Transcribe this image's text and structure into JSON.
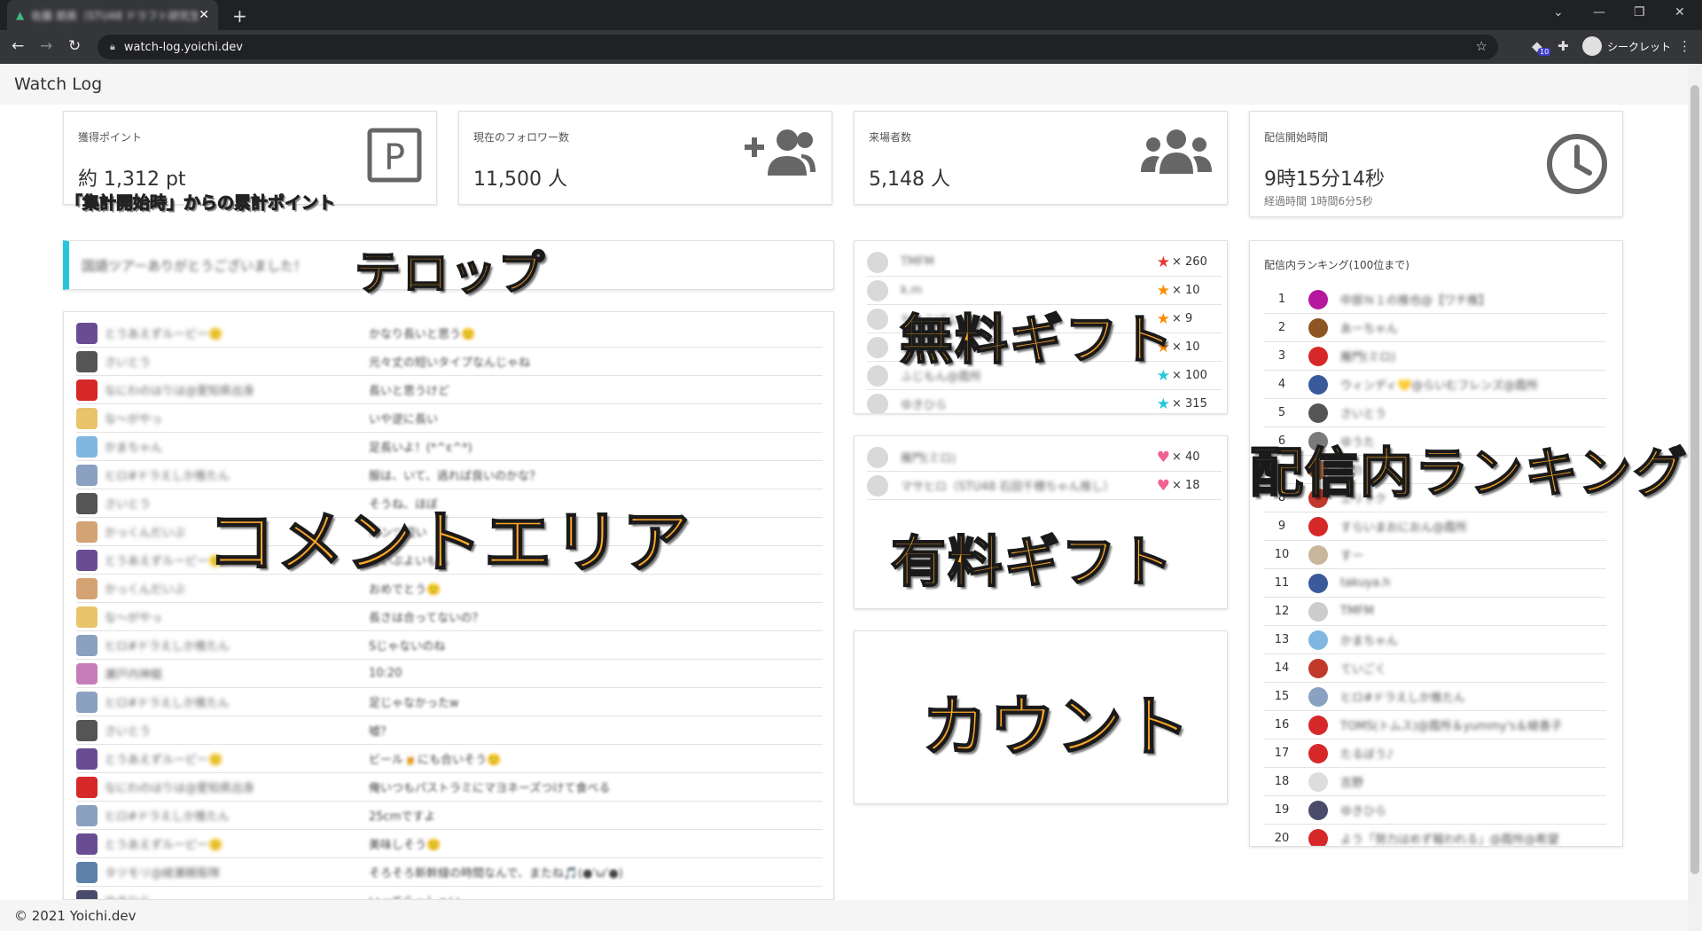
{
  "browser": {
    "tab_title": "佐藤 朋英（STU48 ドラフト研究生）",
    "url": "watch-log.yoichi.dev",
    "extension_badge": "10",
    "profile_label": "シークレット"
  },
  "app": {
    "title": "Watch Log",
    "footer": "© 2021 Yoichi.dev"
  },
  "stats": {
    "points": {
      "label": "獲得ポイント",
      "value": "約 1,312 pt",
      "icon": "parking-icon"
    },
    "followers": {
      "label": "現在のフォロワー数",
      "value": "11,500 人",
      "icon": "person-add-icon"
    },
    "visitors": {
      "label": "来場者数",
      "value": "5,148 人",
      "icon": "group-icon"
    },
    "start_time": {
      "label": "配信開始時間",
      "value": "9時15分14秒",
      "sub": "経過時間 1時間6分5秒",
      "icon": "clock-icon"
    }
  },
  "telop": {
    "text": "国語ツアーありがとうございました！"
  },
  "comments": [
    {
      "name": "とうあえずルーピー🙂",
      "text": "かなり長いと思う🙂",
      "color": "#6a4c93"
    },
    {
      "name": "さいとう",
      "text": "元々丈の短いタイプなんじゃね",
      "color": "#555555"
    },
    {
      "name": "なにわのはりは@愛知県出身",
      "text": "長いと思うけど",
      "color": "#d62828"
    },
    {
      "name": "な～がやっ",
      "text": "いや逆に長い",
      "color": "#e9c46a"
    },
    {
      "name": "かまちゃん",
      "text": "足長いよ！(*^ε^*)",
      "color": "#7fb7e0"
    },
    {
      "name": "ヒロ#ドラえしか推たん",
      "text": "服は、いて、逃れば良いのかな？",
      "color": "#8aa1c1"
    },
    {
      "name": "さいとう",
      "text": "そうね、ほぼ",
      "color": "#555555"
    },
    {
      "name": "かっくんだいぶ",
      "text": "パンツ短い",
      "color": "#d4a373"
    },
    {
      "name": "とうあえずルーピー🙂",
      "text": "だいぶよいもん",
      "color": "#6a4c93"
    },
    {
      "name": "かっくんだいぶ",
      "text": "おめでとう🙂",
      "color": "#d4a373"
    },
    {
      "name": "な～がやっ",
      "text": "長さは合ってないの？",
      "color": "#e9c46a"
    },
    {
      "name": "ヒロ#ドラえしか推たん",
      "text": "Sじゃないのね",
      "color": "#8aa1c1"
    },
    {
      "name": "瀬戸内神龍",
      "text": "10:20",
      "color": "#c77dba"
    },
    {
      "name": "ヒロ#ドラえしか推たん",
      "text": "足じゃなかったw",
      "color": "#8aa1c1"
    },
    {
      "name": "さいとう",
      "text": "嘘？",
      "color": "#555555"
    },
    {
      "name": "とうあえずルーピー🙂",
      "text": "ビール🍺にも合いそう🙂",
      "color": "#6a4c93"
    },
    {
      "name": "なにわのはりは@愛知県出身",
      "text": "俺いつもパストラミにマヨネーズつけて食べる",
      "color": "#d62828"
    },
    {
      "name": "ヒロ#ドラえしか推たん",
      "text": "25cmですよ",
      "color": "#8aa1c1"
    },
    {
      "name": "とうあえずルーピー🙂",
      "text": "美味しそう🙂",
      "color": "#6a4c93"
    },
    {
      "name": "タツモリ@綾瀬親衛隊",
      "text": "そろそろ新幹線の時間なんで、またね🎵(●'ω'●)",
      "color": "#5e81ac"
    },
    {
      "name": "ゆきひら",
      "text": "いってらっしゃい",
      "color": "#4a4a6a"
    }
  ],
  "free_gifts": [
    {
      "name": "TMFM",
      "icon": "red-star-icon",
      "symbol": "★",
      "color": "#e53935",
      "count": "× 260"
    },
    {
      "name": "k.m",
      "icon": "orange-star-icon",
      "symbol": "★",
      "color": "#fb8c00",
      "count": "× 10"
    },
    {
      "name": "ちょこぱん",
      "icon": "orange-star-icon",
      "symbol": "★",
      "color": "#fb8c00",
      "count": "× 9"
    },
    {
      "name": "かまちゃん",
      "icon": "orange-star-icon",
      "symbol": "★",
      "color": "#fb8c00",
      "count": "× 10"
    },
    {
      "name": "ふじもん@霞所",
      "icon": "teal-star-icon",
      "symbol": "★",
      "color": "#26c6da",
      "count": "× 100"
    },
    {
      "name": "ゆきひら",
      "icon": "teal-star-icon",
      "symbol": "★",
      "color": "#26c6da",
      "count": "× 315"
    }
  ],
  "paid_gifts": [
    {
      "name": "雁門(ミロ)",
      "icon": "pink-heart-icon",
      "symbol": "♥",
      "color": "#f06292",
      "count": "× 40"
    },
    {
      "name": "マサヒロ（STU48 石田千穂ちゃん推し）",
      "icon": "pink-heart-icon",
      "symbol": "♥",
      "color": "#f06292",
      "count": "× 18"
    }
  ],
  "ranking": {
    "title": "配信内ランキング(100位まで)",
    "items": [
      {
        "rank": "1",
        "name": "中部Ｎ１の推也@【ワチ推】",
        "color": "#b5179e"
      },
      {
        "rank": "2",
        "name": "あーちゃん",
        "color": "#8d5524"
      },
      {
        "rank": "3",
        "name": "雁門(ミロ)",
        "color": "#d62828"
      },
      {
        "rank": "4",
        "name": "ウィンディ💛@らいむフレンズ@霞所",
        "color": "#3a5a9c"
      },
      {
        "rank": "5",
        "name": "さいとう",
        "color": "#555555"
      },
      {
        "rank": "6",
        "name": "ゆうた",
        "color": "#7a7a7a"
      },
      {
        "rank": "7",
        "name": "きのこ",
        "color": "#9c6644"
      },
      {
        "rank": "8",
        "name": "エリック",
        "color": "#c0392b"
      },
      {
        "rank": "9",
        "name": "すらいまおにおん@霞所",
        "color": "#d62828"
      },
      {
        "rank": "10",
        "name": "すー",
        "color": "#c9b79c"
      },
      {
        "rank": "11",
        "name": "takuya.h",
        "color": "#3a5a9c"
      },
      {
        "rank": "12",
        "name": "TMFM",
        "color": "#cccccc"
      },
      {
        "rank": "13",
        "name": "かまちゃん",
        "color": "#7fb7e0"
      },
      {
        "rank": "14",
        "name": "ていごく",
        "color": "#c0392b"
      },
      {
        "rank": "15",
        "name": "ヒロ#ドラえしか推たん",
        "color": "#8aa1c1"
      },
      {
        "rank": "16",
        "name": "TOMS(トムス)@霞所＆yummy's＆綾香子",
        "color": "#d62828"
      },
      {
        "rank": "17",
        "name": "たるぼう♪",
        "color": "#d62828"
      },
      {
        "rank": "18",
        "name": "吉野",
        "color": "#dddddd"
      },
      {
        "rank": "19",
        "name": "ゆきひら",
        "color": "#4a4a6a"
      },
      {
        "rank": "20",
        "name": "よう「努力はめず報われる」@霞所@希望",
        "color": "#d62828"
      }
    ]
  },
  "annotations": {
    "points": "「集計開始時」からの累計ポイント",
    "telop": "テロップ",
    "comments": "コメントエリア",
    "free_gifts": "無料ギフト",
    "paid_gifts": "有料ギフト",
    "count": "カウント",
    "ranking": "配信内ランキング"
  }
}
